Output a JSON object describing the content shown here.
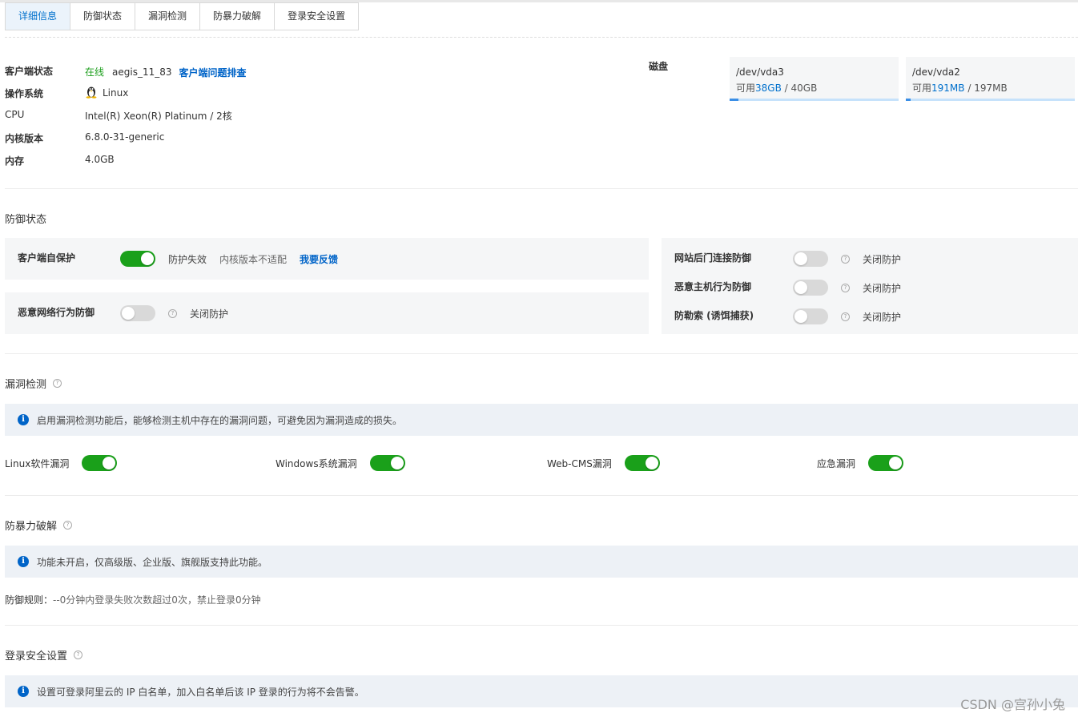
{
  "tabs": [
    {
      "label": "详细信息"
    },
    {
      "label": "防御状态"
    },
    {
      "label": "漏洞检测"
    },
    {
      "label": "防暴力破解"
    },
    {
      "label": "登录安全设置"
    }
  ],
  "details": {
    "client_status_label": "客户端状态",
    "client_status_value": "在线",
    "client_id": "aegis_11_83",
    "troubleshoot_link": "客户端问题排查",
    "os_label": "操作系统",
    "os_value": "Linux",
    "cpu_label": "CPU",
    "cpu_value": "Intel(R) Xeon(R) Platinum / 2核",
    "kernel_label": "内核版本",
    "kernel_value": "6.8.0-31-generic",
    "memory_label": "内存",
    "memory_value": "4.0GB"
  },
  "disk": {
    "label": "磁盘",
    "items": [
      {
        "name": "/dev/vda3",
        "available_prefix": "可用",
        "available": "38GB",
        "total": " / 40GB",
        "used_fraction": 0.05
      },
      {
        "name": "/dev/vda2",
        "available_prefix": "可用",
        "available": "191MB",
        "total": " / 197MB",
        "used_fraction": 0.03
      }
    ]
  },
  "defense": {
    "title": "防御状态",
    "self_protect": {
      "label": "客户端自保护",
      "on": true,
      "status": "防护失效",
      "reason": "内核版本不适配",
      "feedback": "我要反馈"
    },
    "malicious_network": {
      "label": "恶意网络行为防御",
      "on": false,
      "status": "关闭防护"
    },
    "webshell": {
      "label": "网站后门连接防御",
      "on": false,
      "status": "关闭防护"
    },
    "malicious_host": {
      "label": "恶意主机行为防御",
      "on": false,
      "status": "关闭防护"
    },
    "ransomware": {
      "label": "防勒索 (诱饵捕获)",
      "on": false,
      "status": "关闭防护"
    }
  },
  "vuln": {
    "title": "漏洞检测",
    "notice": "启用漏洞检测功能后，能够检测主机中存在的漏洞问题，可避免因为漏洞造成的损失。",
    "items": [
      {
        "label": "Linux软件漏洞",
        "on": true
      },
      {
        "label": "Windows系统漏洞",
        "on": true
      },
      {
        "label": "Web-CMS漏洞",
        "on": true
      },
      {
        "label": "应急漏洞",
        "on": true
      }
    ]
  },
  "brute": {
    "title": "防暴力破解",
    "notice": "功能未开启，仅高级版、企业版、旗舰版支持此功能。",
    "rule_label": "防御规则：",
    "rule_value": "--0分钟内登录失败次数超过0次，禁止登录0分钟"
  },
  "login": {
    "title": "登录安全设置",
    "notice": "设置可登录阿里云的 IP 白名单，加入白名单后该 IP 登录的行为将不会告警。"
  },
  "watermark": "CSDN @宫孙小兔",
  "colors": {
    "accent": "#0070cc",
    "switch_on": "#1aa01a",
    "online": "#1e9f1e"
  }
}
